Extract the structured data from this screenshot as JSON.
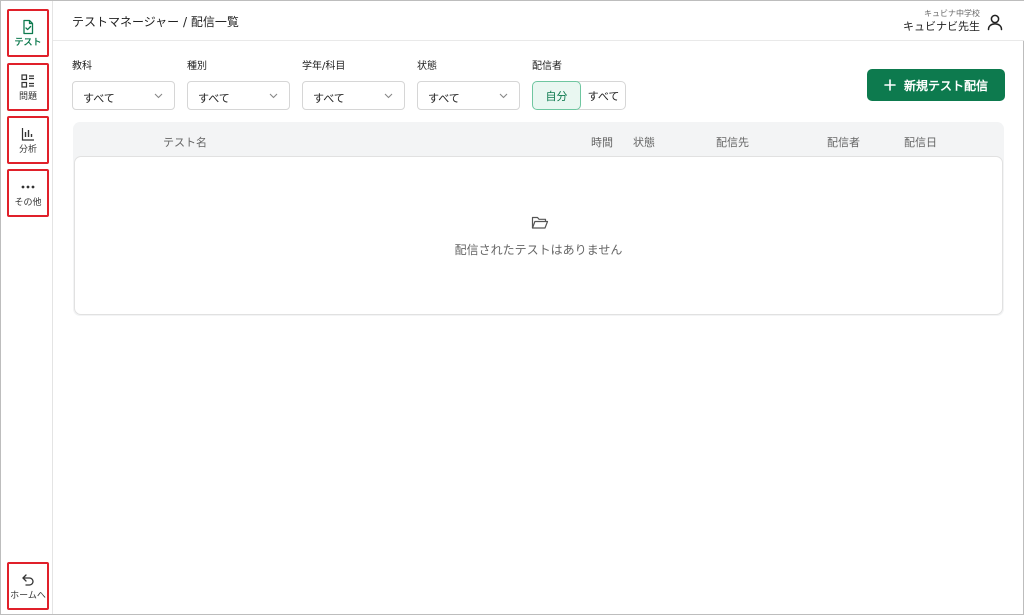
{
  "sidebar": {
    "items": [
      {
        "label": "テスト",
        "icon": "document-check-icon",
        "active": true
      },
      {
        "label": "問題",
        "icon": "list-grid-icon",
        "active": false
      },
      {
        "label": "分析",
        "icon": "bar-chart-icon",
        "active": false
      },
      {
        "label": "その他",
        "icon": "more-dots-icon",
        "active": false
      }
    ],
    "home": {
      "label": "ホームへ",
      "icon": "return-arrow-icon"
    }
  },
  "header": {
    "breadcrumb": "テストマネージャー / 配信一覧",
    "school": "キュビナ中学校",
    "teacher": "キュビナビ先生",
    "user_icon": "user-icon"
  },
  "filters": {
    "subject": {
      "label": "教科",
      "value": "すべて"
    },
    "type": {
      "label": "種別",
      "value": "すべて"
    },
    "grade": {
      "label": "学年/科目",
      "value": "すべて"
    },
    "status": {
      "label": "状態",
      "value": "すべて"
    },
    "distributor": {
      "label": "配信者",
      "options": [
        "自分",
        "すべて"
      ],
      "selected": "自分"
    }
  },
  "actions": {
    "new_test": {
      "label": "新規テスト配信",
      "icon": "plus-icon"
    }
  },
  "table": {
    "columns": [
      "テスト名",
      "時間",
      "状態",
      "配信先",
      "配信者",
      "配信日"
    ],
    "rows": [],
    "empty": {
      "icon": "folder-open-icon",
      "message": "配信されたテストはありません"
    }
  },
  "colors": {
    "accent": "#0d7a4e",
    "accent_light": "#e9f7f1",
    "highlight_border": "#e0202a"
  }
}
